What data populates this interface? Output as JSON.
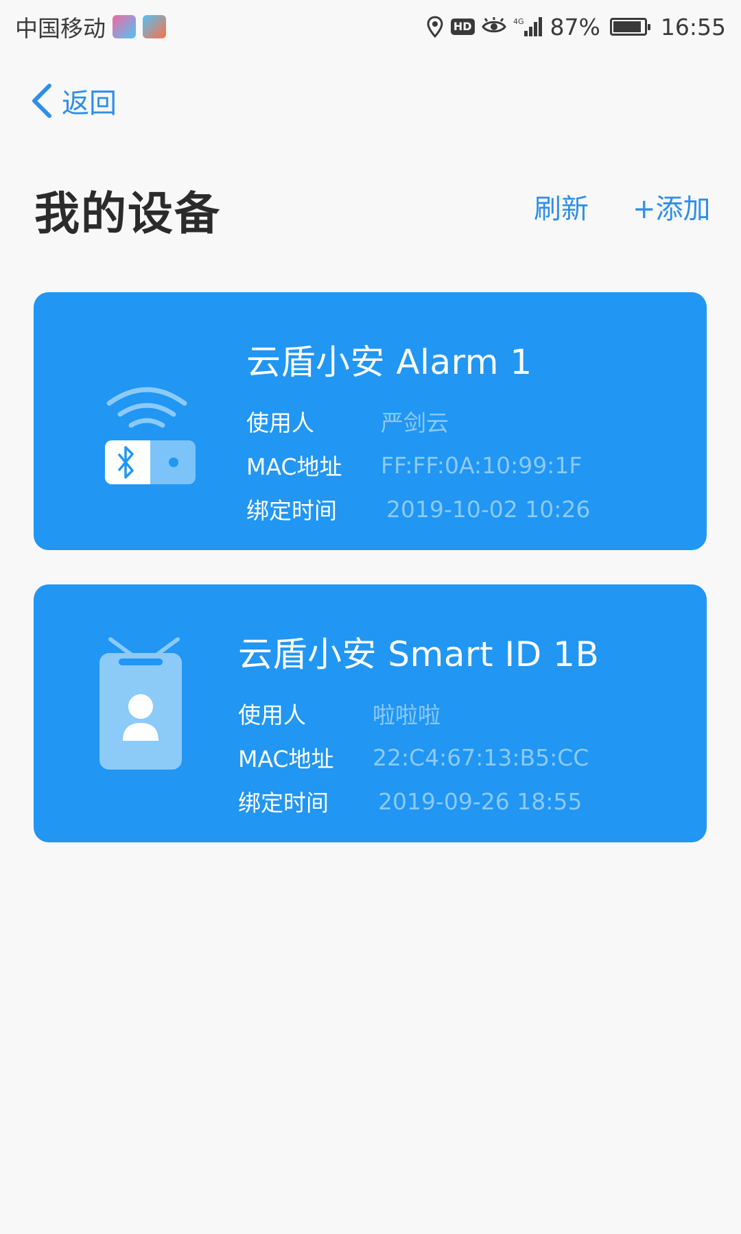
{
  "status_bar": {
    "carrier": "中国移动",
    "hd_label": "HD",
    "network": "4G",
    "battery": "87%",
    "time": "16:55",
    "icons": [
      "app-icon-1",
      "app-icon-2",
      "location-icon",
      "hd-icon",
      "eye-icon",
      "signal-icon",
      "battery-icon"
    ]
  },
  "header": {
    "back_label": "返回",
    "title": "我的设备",
    "refresh_label": "刷新",
    "add_label": "+添加"
  },
  "colors": {
    "accent": "#2f8ee8",
    "card_background": "#2196f3",
    "value_text": "#8ccaf8",
    "page_background": "#f8f8f9"
  },
  "devices": [
    {
      "name": "云盾小安 Alarm 1",
      "icon": "bluetooth-alarm-icon",
      "user_label": "使用人",
      "user": "严剑云",
      "mac_label": "MAC地址",
      "mac": "FF:FF:0A:10:99:1F",
      "bind_time_label": "绑定时间",
      "bind_time": "2019-10-02 10:26"
    },
    {
      "name": "云盾小安 Smart ID 1B",
      "icon": "id-badge-icon",
      "user_label": "使用人",
      "user": "啦啦啦",
      "mac_label": "MAC地址",
      "mac": "22:C4:67:13:B5:CC",
      "bind_time_label": "绑定时间",
      "bind_time": "2019-09-26 18:55"
    }
  ]
}
